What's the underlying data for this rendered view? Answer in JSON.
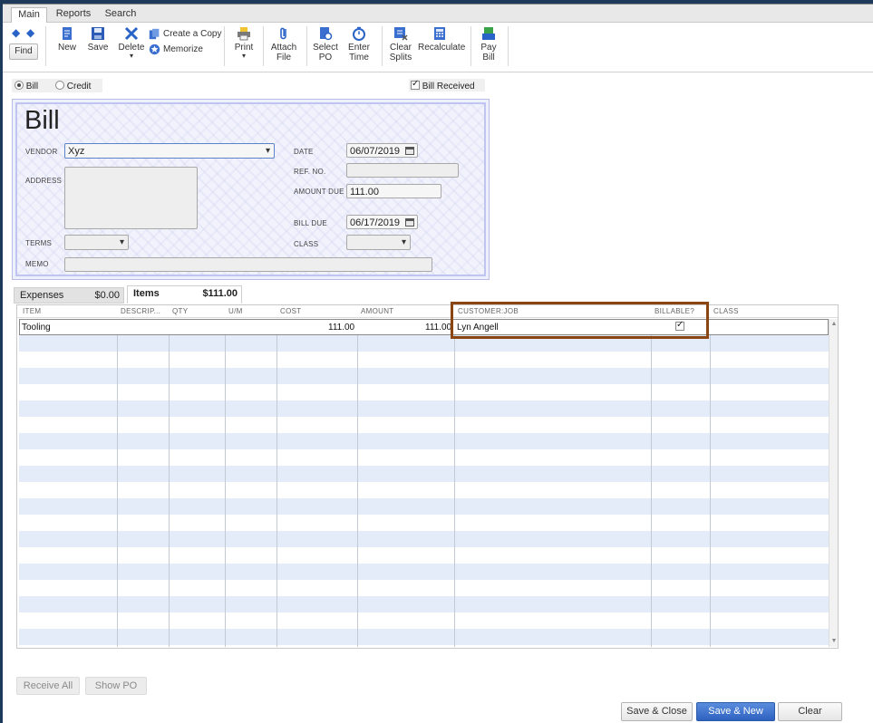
{
  "tabs": [
    "Main",
    "Reports",
    "Search"
  ],
  "toolbar": {
    "find": "Find",
    "new": "New",
    "save": "Save",
    "delete": "Delete",
    "create_copy": "Create a Copy",
    "memorize": "Memorize",
    "print": "Print",
    "attach_1": "Attach",
    "attach_2": "File",
    "select_1": "Select",
    "select_2": "PO",
    "enter_1": "Enter",
    "enter_2": "Time",
    "clear_1": "Clear",
    "clear_2": "Splits",
    "recalculate": "Recalculate",
    "pay_1": "Pay",
    "pay_2": "Bill"
  },
  "mode": {
    "bill": "Bill",
    "credit": "Credit",
    "bill_received": "Bill Received"
  },
  "form": {
    "title": "Bill",
    "vendor_label": "VENDOR",
    "vendor": "Xyz",
    "address_label": "ADDRESS",
    "terms_label": "TERMS",
    "memo_label": "MEMO",
    "date_label": "DATE",
    "date": "06/07/2019",
    "ref_label": "REF. NO.",
    "amount_due_label": "AMOUNT DUE",
    "amount_due": "111.00",
    "bill_due_label": "BILL DUE",
    "bill_due": "06/17/2019",
    "class_label": "CLASS"
  },
  "subtabs": {
    "expenses_label": "Expenses",
    "expenses_amount": "$0.00",
    "items_label": "Items",
    "items_amount": "$111.00"
  },
  "grid": {
    "headers": [
      "ITEM",
      "DESCRIP...",
      "QTY",
      "U/M",
      "COST",
      "AMOUNT",
      "CUSTOMER:JOB",
      "BILLABLE?",
      "CLASS"
    ],
    "row": {
      "item": "Tooling",
      "cost": "111.00",
      "amount": "111.00",
      "customer_job": "Lyn Angell",
      "billable": true
    }
  },
  "buttons": {
    "receive_all": "Receive All",
    "show_po": "Show PO",
    "save_close": "Save & Close",
    "save_new": "Save & New",
    "clear": "Clear"
  },
  "colors": {
    "accent": "#2e62c0",
    "highlight": "#8b4513",
    "stripe": "#e3ecf8"
  }
}
